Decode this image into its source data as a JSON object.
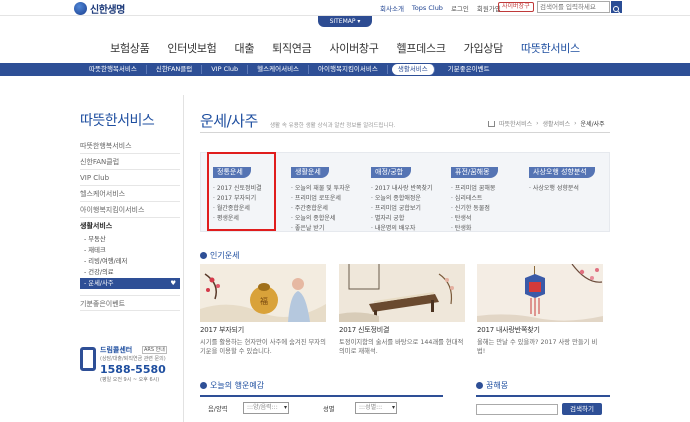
{
  "header": {
    "logo_text": "신한생명",
    "top_links": [
      "회사소개",
      "Tops Club",
      "로그인",
      "회원가입"
    ],
    "member_button": "사이버창구",
    "search_placeholder": "검색어를 입력하세요",
    "sitemap_label": "SITEMAP ▾"
  },
  "gnb": {
    "items": [
      "보험상품",
      "인터넷보험",
      "대출",
      "퇴직연금",
      "사이버창구",
      "헬프데스크",
      "가입상담",
      "따뜻한서비스"
    ],
    "active_index": 7
  },
  "subnav": {
    "items": [
      "따뜻한행복서비스",
      "신한FAN클럽",
      "VIP Club",
      "헬스케어서비스",
      "아이행복지킴이서비스",
      "생활서비스",
      "기분좋은이벤트"
    ],
    "active_index": 5
  },
  "sidebar": {
    "title": "따뜻한서비스",
    "items": [
      "따뜻한행복서비스",
      "신한FAN클럽",
      "VIP Club",
      "헬스케어서비스",
      "아이행복지킴이서비스"
    ],
    "current_group": "생활서비스",
    "sub_items": [
      "부동산",
      "재테크",
      "리빙/여행/레저",
      "건강/의료",
      "운세/사주"
    ],
    "last_item": "기분좋은이벤트",
    "callcenter": {
      "title": "드림콜센터",
      "ars": "ARS 안내",
      "desc": "(상담/대출/퇴직연금 관련 문의)",
      "number": "1588-5580",
      "hours": "(평일 오전 9시 ~ 오후 6시)"
    }
  },
  "page": {
    "title": "운세/사주",
    "description": "생활 속 유용한 생활 상식과 알찬 정보를 알려드립니다.",
    "breadcrumb": [
      "따뜻한서비스",
      "생활서비스",
      "운세/사주"
    ]
  },
  "categories": [
    {
      "title": "정통운세",
      "items": [
        "2017 신토정비결",
        "2017 부자되기",
        "월간종합운세",
        "평생운세"
      ]
    },
    {
      "title": "생활운세",
      "items": [
        "오늘의 재물 및 투자운",
        "프리미엄 로또운세",
        "주간종합운세",
        "오늘의 종합운세",
        "좋은날 받기"
      ]
    },
    {
      "title": "애정/궁합",
      "items": [
        "2017 내사랑 반쪽찾기",
        "오늘의 종합애정운",
        "프리미엄 궁합보기",
        "별자리 궁합",
        "내운명의 배우자"
      ]
    },
    {
      "title": "퓨전/꿈해몽",
      "items": [
        "프리미엄 꿈해몽",
        "심리테스트",
        "신기한 동물점",
        "탄생석",
        "탄생화"
      ]
    },
    {
      "title": "사상오행 성향분석",
      "items": [
        "사상오행 성향분석"
      ]
    }
  ],
  "popular": {
    "title": "인기운세",
    "cards": [
      {
        "name": "2017 부자되기",
        "desc": "시기를 활용하는 현자만이 사주에 숨겨진 부자의 기운을 이용할 수 있습니다."
      },
      {
        "name": "2017 신토정비결",
        "desc": "토정이지함의 술서를 바탕으로 144괘를 현대적 의미로 재해석."
      },
      {
        "name": "2017 내사랑반쪽찾기",
        "desc": "올해는 만날 수 있을까? 2017 사랑 만들기 비법!"
      }
    ]
  },
  "horoscope": {
    "title": "오늘의 행운예감",
    "birth_label": "음/양력",
    "birth_select": ":::양/음력:::",
    "gender_label": "성별",
    "gender_select": ":::성별:::"
  },
  "dream": {
    "title": "꿈해몽",
    "button": "검색하기"
  }
}
